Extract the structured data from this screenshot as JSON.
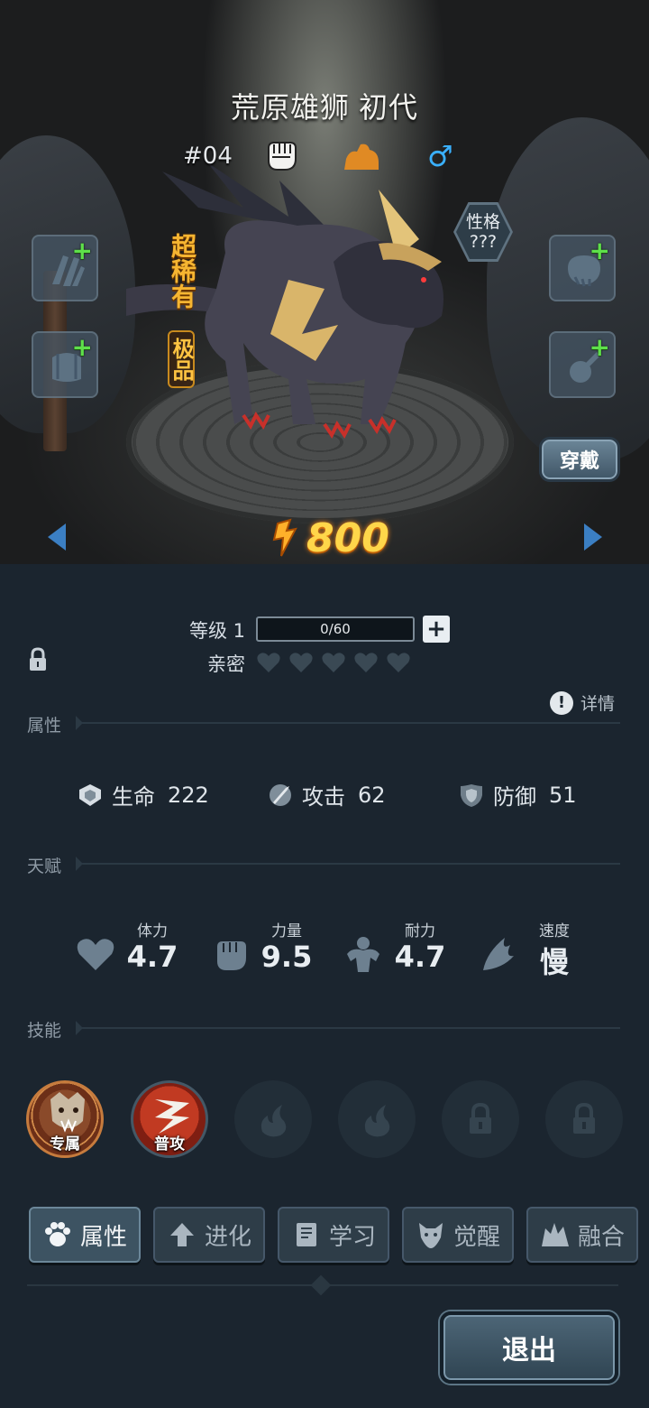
{
  "pet": {
    "name": "荒原雄狮",
    "generation": "初代",
    "number": "#04",
    "rarity": "超稀有",
    "grade": "极品",
    "trait_label": "性格",
    "trait_value": "???",
    "power": "800",
    "icons": [
      "fist-icon",
      "terrain-icon",
      "male-gender-icon"
    ]
  },
  "equipment": {
    "slots": [
      "claw-gear-slot",
      "armor-gear-slot",
      "paw-gear-slot",
      "accessory-gear-slot"
    ],
    "wear_label": "穿戴"
  },
  "level": {
    "label": "等级 1",
    "exp": "0/60"
  },
  "intimacy": {
    "label": "亲密",
    "hearts_filled": 0,
    "hearts_total": 5
  },
  "detail_label": "详情",
  "sections": {
    "attributes": "属性",
    "talent": "天赋",
    "skills": "技能"
  },
  "attributes": [
    {
      "label": "生命",
      "value": "222",
      "icon": "heart-shield-icon"
    },
    {
      "label": "攻击",
      "value": "62",
      "icon": "sword-icon"
    },
    {
      "label": "防御",
      "value": "51",
      "icon": "shield-icon"
    }
  ],
  "talents": [
    {
      "label": "体力",
      "value": "4.7",
      "icon": "heart-icon"
    },
    {
      "label": "力量",
      "value": "9.5",
      "icon": "fist-icon"
    },
    {
      "label": "耐力",
      "value": "4.7",
      "icon": "muscle-icon"
    },
    {
      "label": "速度",
      "value": "慢",
      "icon": "wing-icon"
    }
  ],
  "skills": [
    {
      "caption": "专属",
      "state": "exclusive"
    },
    {
      "caption": "普攻",
      "state": "normal"
    },
    {
      "caption": "",
      "state": "empty"
    },
    {
      "caption": "",
      "state": "empty"
    },
    {
      "caption": "",
      "state": "locked"
    },
    {
      "caption": "",
      "state": "locked"
    }
  ],
  "tabs": [
    {
      "label": "属性",
      "icon": "paw-icon",
      "active": true
    },
    {
      "label": "进化",
      "icon": "evolve-arrow-icon",
      "active": false
    },
    {
      "label": "学习",
      "icon": "book-icon",
      "active": false
    },
    {
      "label": "觉醒",
      "icon": "wolf-head-icon",
      "active": false
    },
    {
      "label": "融合",
      "icon": "fusion-icon",
      "active": false
    }
  ],
  "exit_label": "退出",
  "colors": {
    "power": "#ffd64a",
    "rarity": "#f6b531",
    "plus": "#5ee04a",
    "male": "#3ab0ff",
    "nav_arrow": "#3b7fc3"
  }
}
